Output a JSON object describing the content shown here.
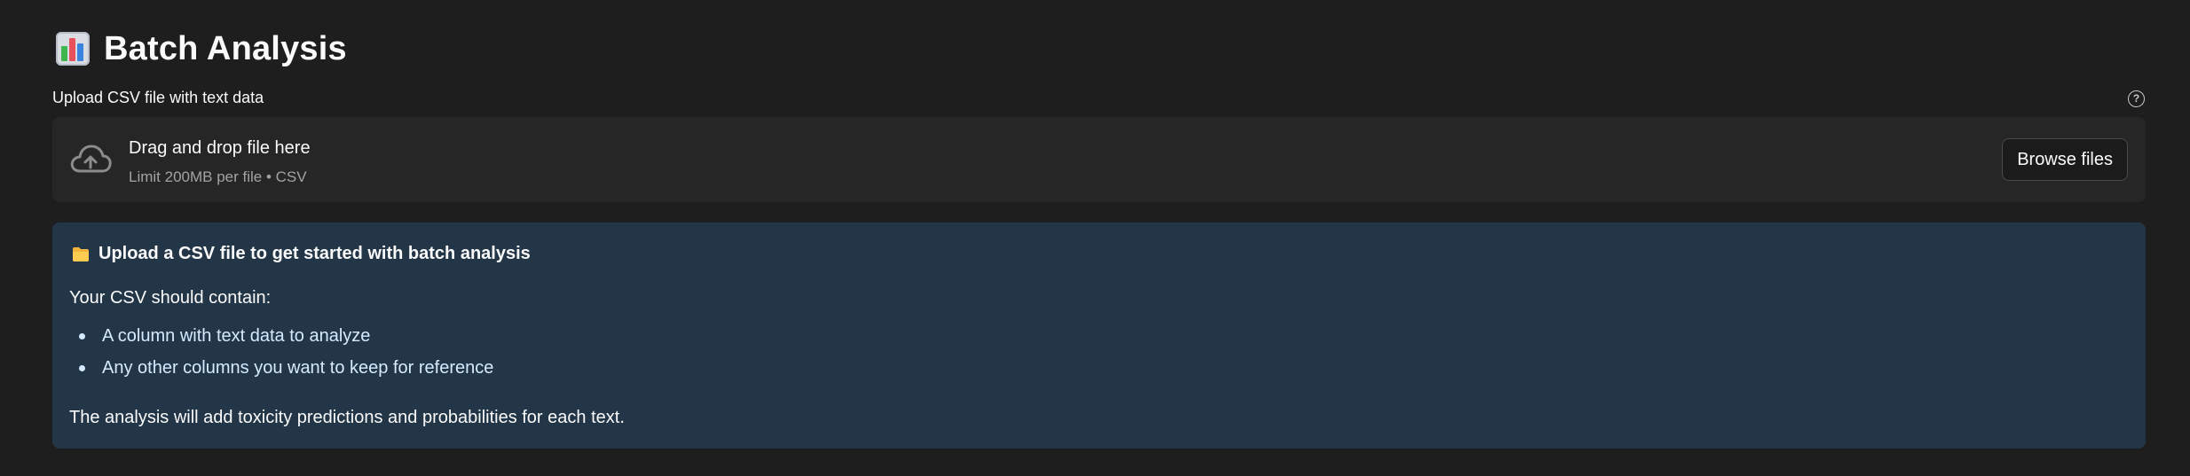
{
  "header": {
    "icon": "bar-chart-emoji-icon",
    "title": "Batch Analysis"
  },
  "uploader": {
    "label": "Upload CSV file with text data",
    "help_icon": "question-circle-icon",
    "help_glyph": "?",
    "dropzone": {
      "icon": "cloud-upload-icon",
      "main_text": "Drag and drop file here",
      "sub_text": "Limit 200MB per file • CSV"
    },
    "browse_label": "Browse files"
  },
  "info": {
    "icon": "folder-emoji-icon",
    "title": "Upload a CSV file to get started with batch analysis",
    "intro": "Your CSV should contain:",
    "items": [
      "A column with text data to analyze",
      "Any other columns you want to keep for reference"
    ],
    "outro": "The analysis will add toxicity predictions and probabilities for each text."
  },
  "colors": {
    "background": "#1e1e1e",
    "dropzone": "#262626",
    "info_background": "#233648",
    "info_list_text": "#d6eaff"
  }
}
